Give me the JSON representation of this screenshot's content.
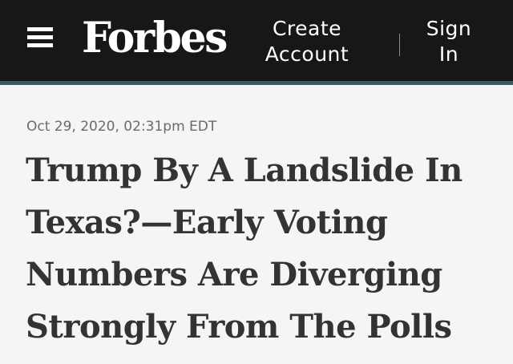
{
  "header": {
    "menu_icon": "hamburger-menu-icon",
    "logo_text": "Forbes",
    "create_account_label": "Create Account",
    "sign_in_label": "Sign In",
    "background_color": "#181716",
    "accent_color": "#385b6a"
  },
  "article": {
    "timestamp": "Oct 29, 2020, 02:31pm EDT",
    "headline": "Trump By A Landslide In Texas?—Early Voting Numbers Are Diverging Strongly From The Polls"
  }
}
